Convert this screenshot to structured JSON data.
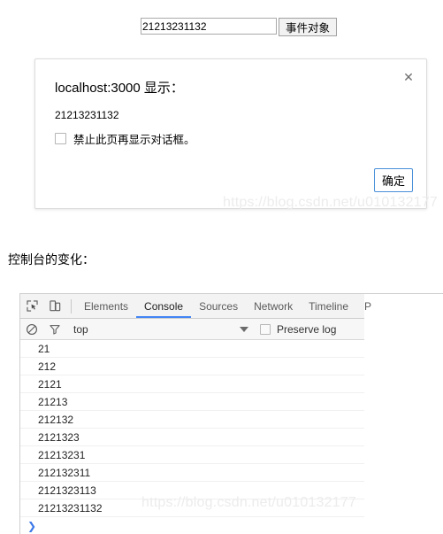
{
  "page": {
    "input": {
      "value": "21213231132",
      "placeholder": ""
    },
    "submit_label": "事件对象",
    "section_heading": "控制台的变化："
  },
  "dialog": {
    "title": "localhost:3000 显示：",
    "message": "21213231132",
    "suppress_label": "禁止此页再显示对话框。",
    "ok_label": "确定",
    "close_icon": "✕",
    "accent_color": "#4a90d9"
  },
  "watermark": {
    "text": "https://blog.csdn.net/u010132177"
  },
  "devtools": {
    "tabs": [
      {
        "label": "Elements",
        "active": false
      },
      {
        "label": "Console",
        "active": true
      },
      {
        "label": "Sources",
        "active": false
      },
      {
        "label": "Network",
        "active": false
      },
      {
        "label": "Timeline",
        "active": false
      },
      {
        "label": "P",
        "active": false
      }
    ],
    "active_tab_color": "#4285f4",
    "filter_bar": {
      "context": "top",
      "preserve_log_label": "Preserve log",
      "preserve_log_checked": false
    },
    "console_rows": [
      "21",
      "212",
      "2121",
      "21213",
      "212132",
      "2121323",
      "21213231",
      "212132311",
      "2121323113",
      "21213231132"
    ],
    "prompt": "❯"
  }
}
